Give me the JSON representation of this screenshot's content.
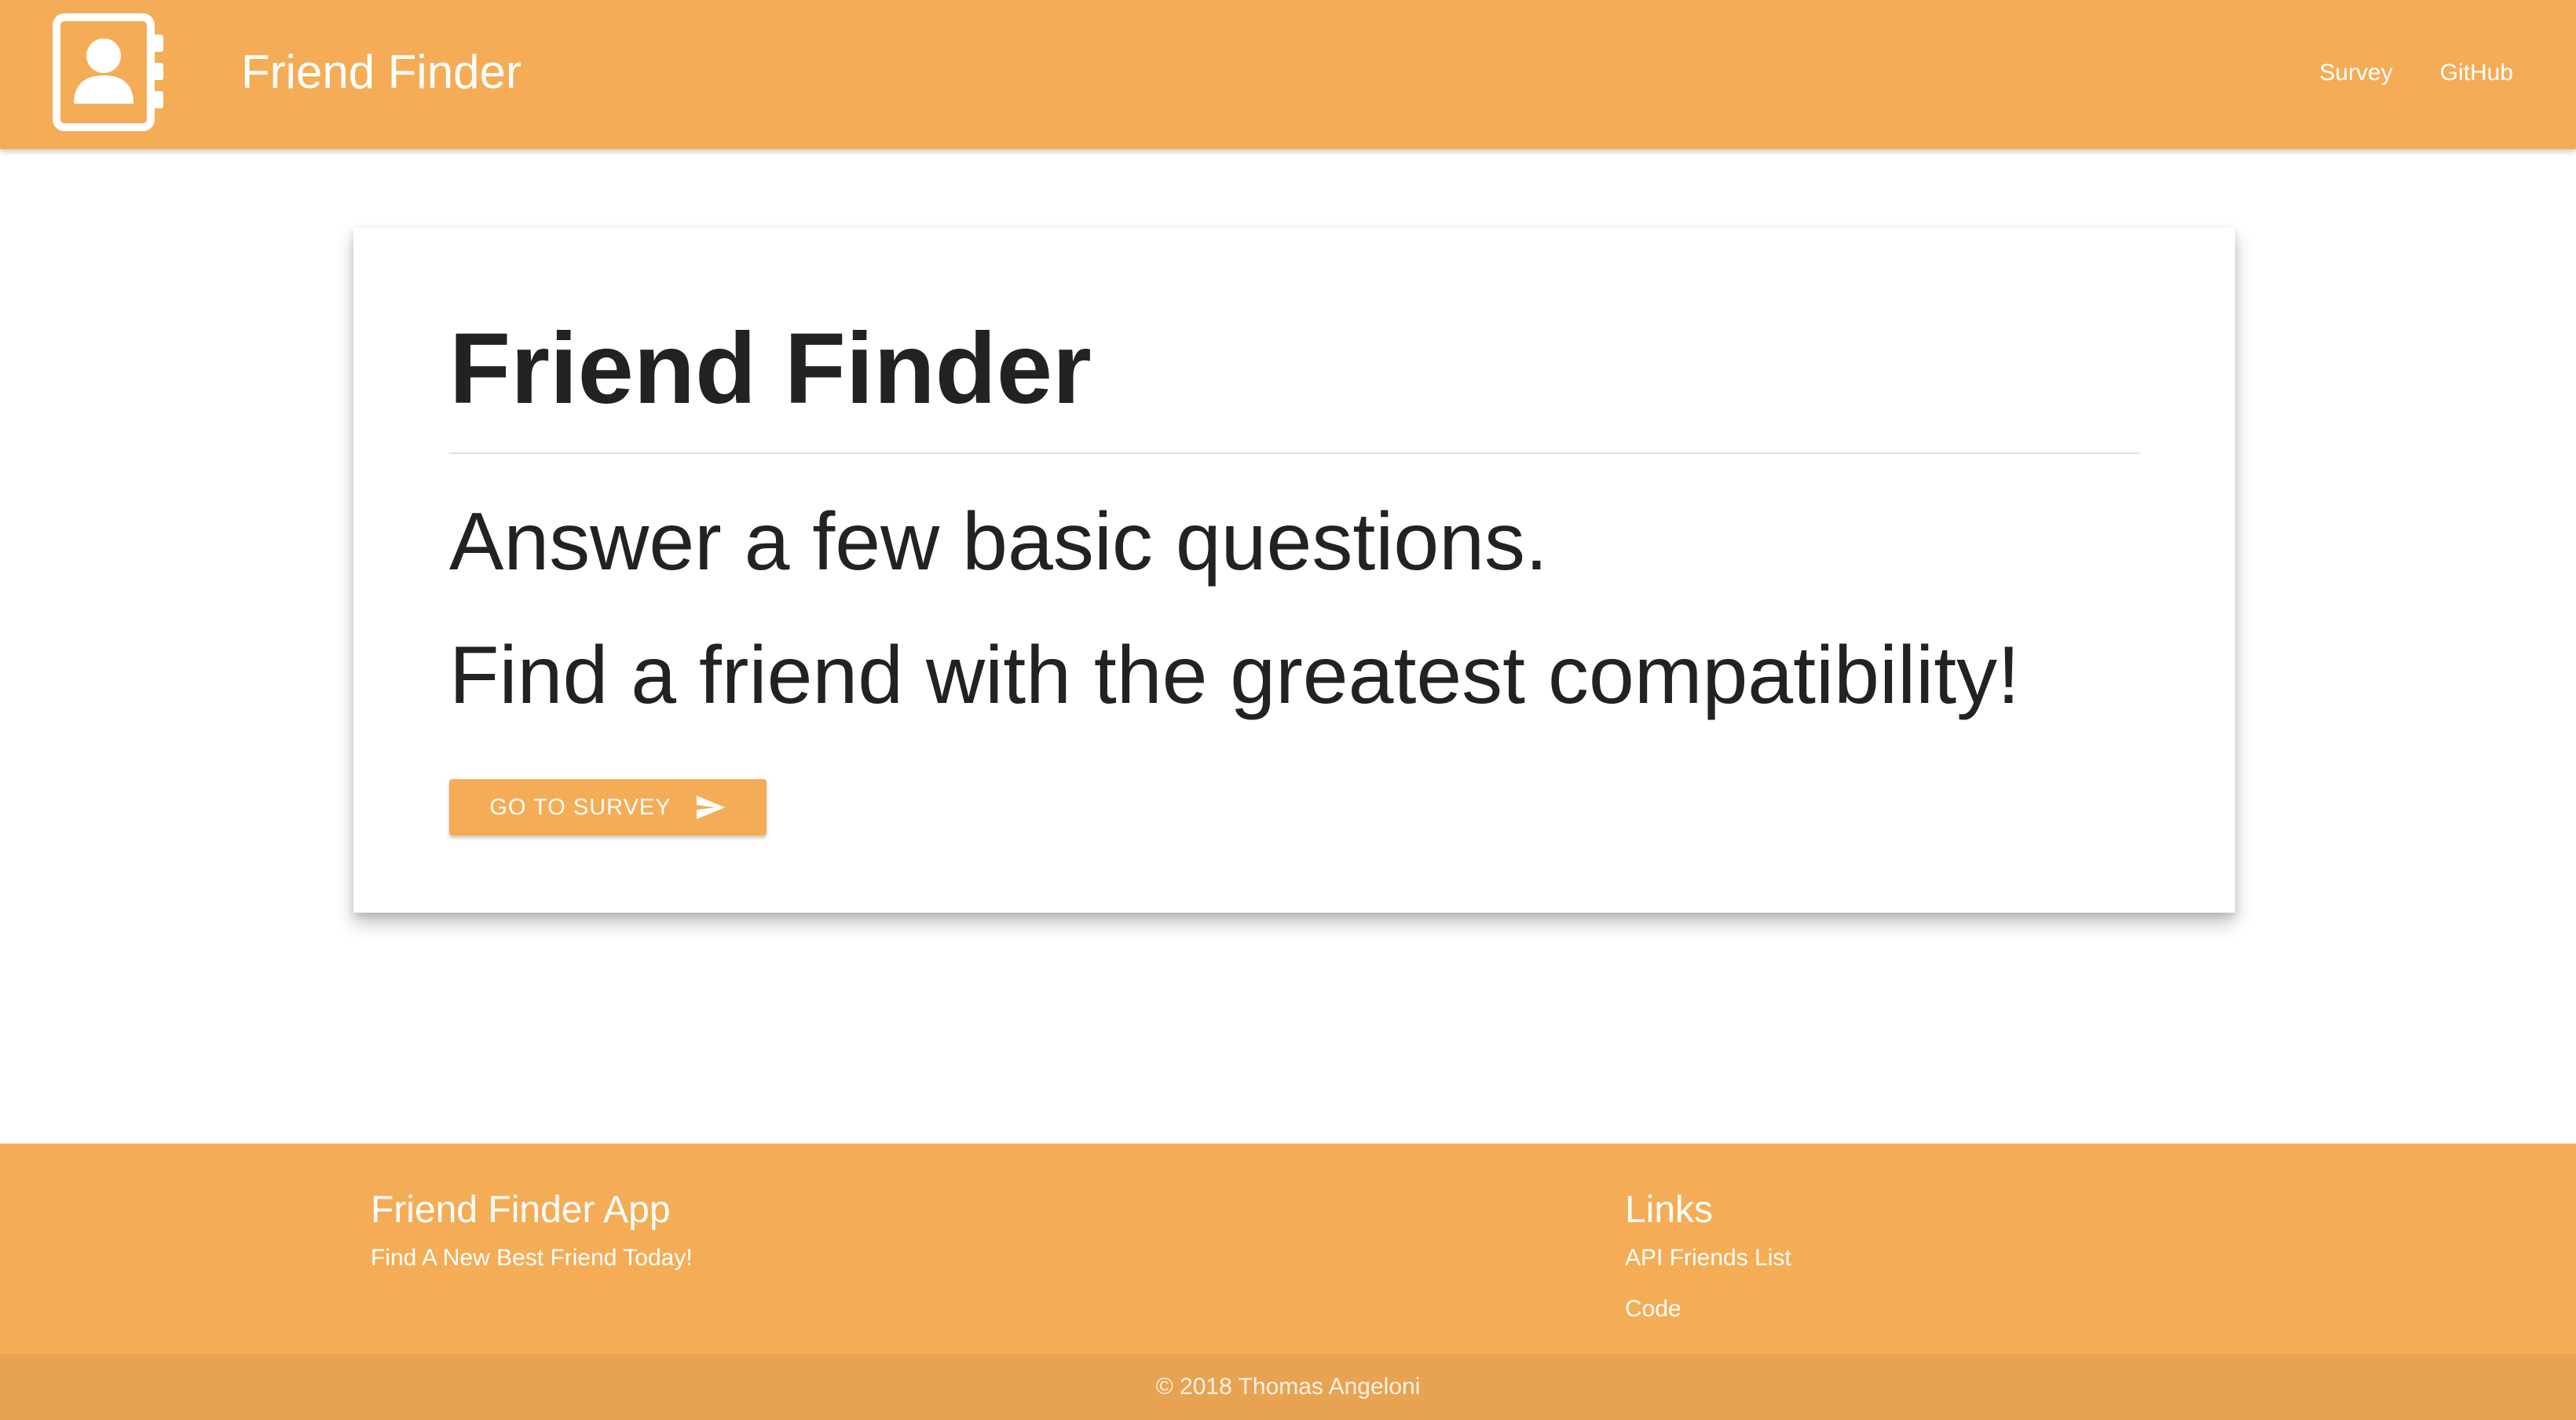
{
  "brand_color": "#f4ad56",
  "navbar": {
    "logo_icon": "contact-book-icon",
    "brand": "Friend Finder",
    "links": [
      {
        "label": "Survey"
      },
      {
        "label": "GitHub"
      }
    ]
  },
  "card": {
    "title": "Friend Finder",
    "line1": "Answer a few basic questions.",
    "line2": "Find a friend with the greatest compatibility!",
    "button": {
      "label": "GO TO SURVEY",
      "icon": "send-icon"
    }
  },
  "footer": {
    "left": {
      "heading": "Friend Finder App",
      "text": "Find A New Best Friend Today!"
    },
    "right": {
      "heading": "Links",
      "links": [
        {
          "label": "API Friends List"
        },
        {
          "label": "Code"
        }
      ]
    },
    "copyright": "© 2018 Thomas Angeloni"
  }
}
